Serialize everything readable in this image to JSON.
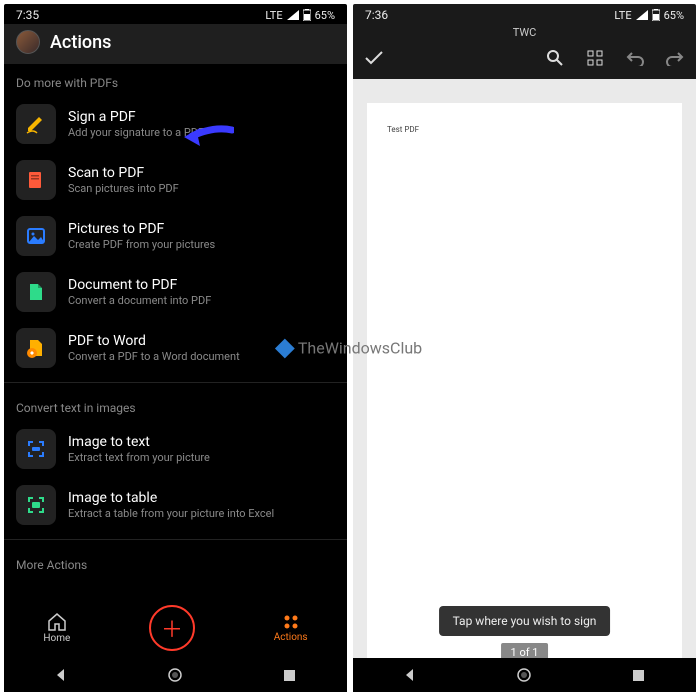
{
  "left": {
    "status": {
      "time": "7:35",
      "net": "LTE",
      "battery": "65%"
    },
    "header": {
      "title": "Actions"
    },
    "section1": "Do more with PDFs",
    "actions": [
      {
        "title": "Sign a PDF",
        "sub": "Add your signature to a PDF",
        "color": "#f7b500",
        "icon": "pen"
      },
      {
        "title": "Scan to PDF",
        "sub": "Scan pictures into PDF",
        "color": "#ff5a3a",
        "icon": "scan"
      },
      {
        "title": "Pictures to PDF",
        "sub": "Create PDF from your pictures",
        "color": "#2a7cff",
        "icon": "picture"
      },
      {
        "title": "Document to PDF",
        "sub": "Convert a document into PDF",
        "color": "#2edb8a",
        "icon": "doc"
      },
      {
        "title": "PDF to Word",
        "sub": "Convert a PDF to a Word document",
        "color": "#ffb000",
        "icon": "pdfword"
      }
    ],
    "section2": "Convert text in images",
    "actions2": [
      {
        "title": "Image to text",
        "sub": "Extract text from your picture",
        "color": "#2a7cff",
        "icon": "imgtext"
      },
      {
        "title": "Image to table",
        "sub": "Extract a table from your picture into Excel",
        "color": "#2edb8a",
        "icon": "imgtable"
      }
    ],
    "section3": "More Actions",
    "nav": {
      "home": "Home",
      "actions": "Actions"
    }
  },
  "right": {
    "status": {
      "time": "7:36",
      "net": "LTE",
      "battery": "65%"
    },
    "doc_title": "TWC",
    "page_text": "Test PDF",
    "toast": "Tap where you wish to sign",
    "page_indicator": "1 of 1"
  },
  "watermark": "TheWindowsClub"
}
